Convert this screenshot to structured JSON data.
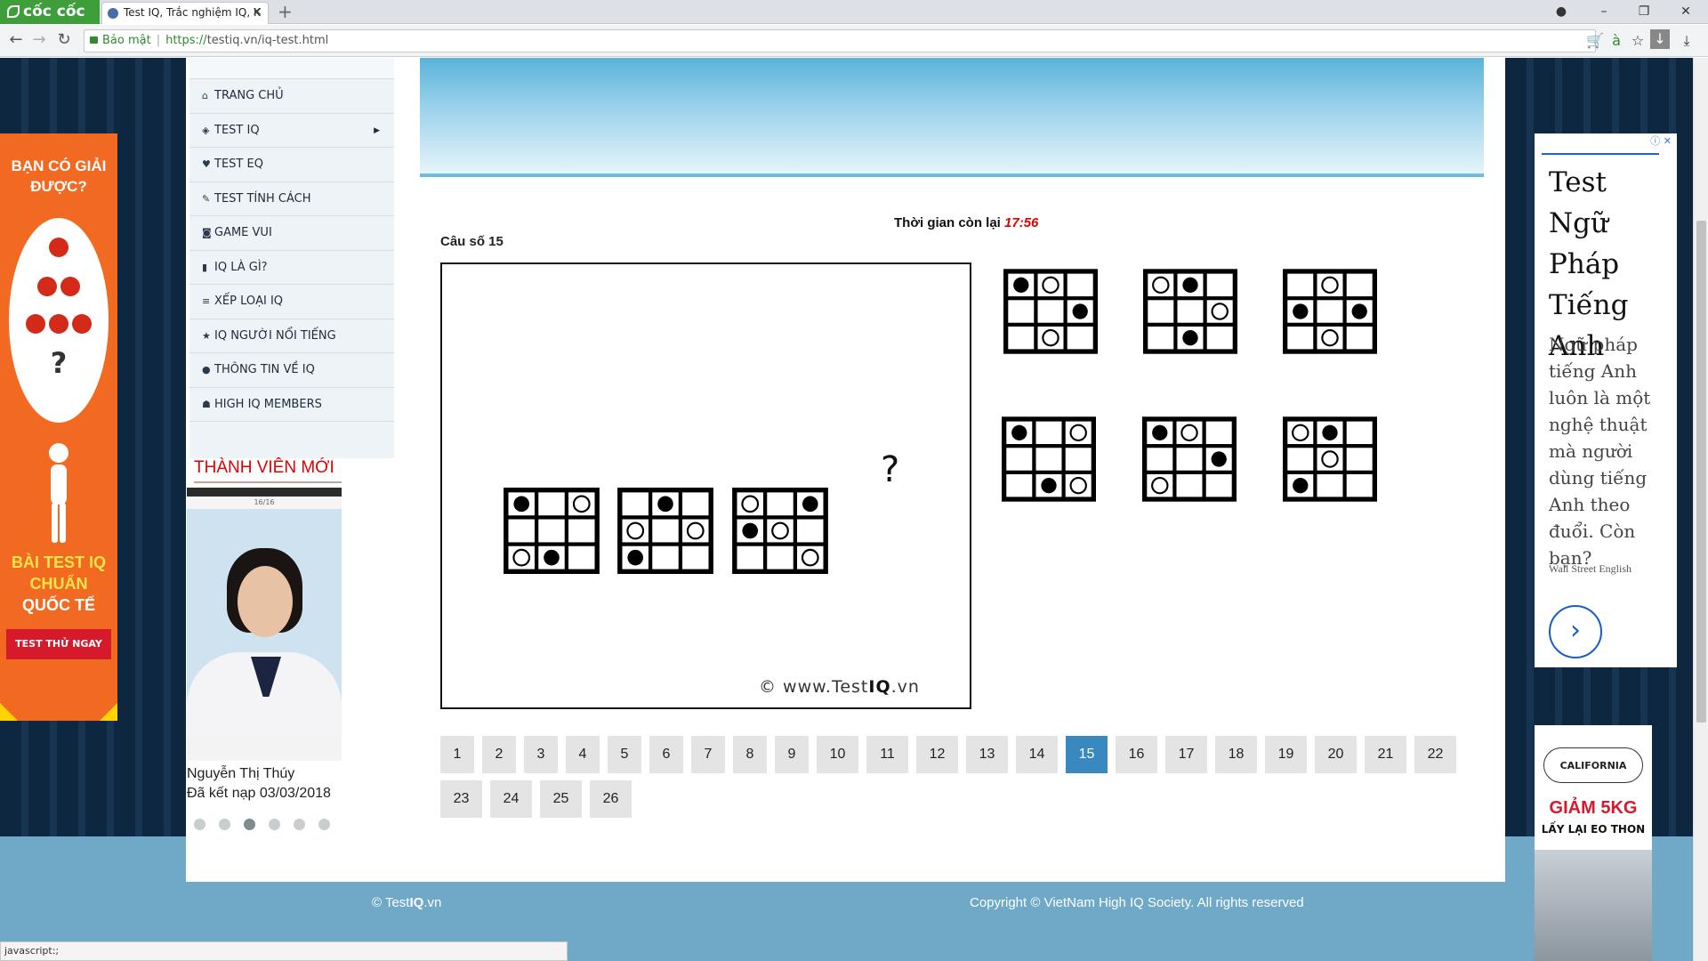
{
  "browser": {
    "brand": "cốc cốc",
    "tab_title": "Test IQ, Trắc nghiệm IQ, K",
    "secure_label": "Bảo mật",
    "url_https": "https://",
    "url_rest": "testiq.vn/iq-test.html"
  },
  "menu": {
    "items": [
      {
        "label": "Trang chủ",
        "icon": "home-icon"
      },
      {
        "label": "Test IQ",
        "icon": "brain-icon",
        "has_submenu": true
      },
      {
        "label": "Test EQ",
        "icon": "heart-icon"
      },
      {
        "label": "Test tính cách",
        "icon": "chat-icon"
      },
      {
        "label": "Game vui",
        "icon": "gamepad-icon"
      },
      {
        "label": "IQ là gì?",
        "icon": "book-icon"
      },
      {
        "label": "Xếp loại IQ",
        "icon": "list-icon"
      },
      {
        "label": "IQ người nổi tiếng",
        "icon": "star-icon"
      },
      {
        "label": "Thông tin về IQ",
        "icon": "info-icon"
      },
      {
        "label": "High IQ members",
        "icon": "users-icon"
      }
    ]
  },
  "new_members": {
    "title": "THÀNH VIÊN MỚI",
    "photo_header": "16/16",
    "name": "Nguyễn Thị Thúy",
    "joined": "Đã kết nạp 03/03/2018",
    "dot_count": 6,
    "active_dot": 3
  },
  "ad_left": {
    "top": "BẠN CÓ GIẢI ĐƯỢC?",
    "question": "?",
    "bottom_line1": "BÀI TEST IQ",
    "bottom_line2": "CHUẨN",
    "bottom_line3": "QUỐC TẾ",
    "cta": "TEST THỬ NGAY"
  },
  "quiz": {
    "timer_label": "Thời gian còn lại",
    "timer_value": "17:56",
    "question_label": "Câu số 15",
    "missing_mark": "?",
    "watermark_prefix": "© www.Test",
    "watermark_bold": "IQ",
    "watermark_suffix": ".vn"
  },
  "puzzle": {
    "sequence": [
      {
        "cells": [
          "B",
          "",
          "W",
          "",
          "",
          "",
          "W",
          "B",
          ""
        ]
      },
      {
        "cells": [
          "",
          "B",
          "",
          "W",
          "",
          "W",
          "B",
          "",
          ""
        ]
      },
      {
        "cells": [
          "W",
          "",
          "B",
          "B",
          "W",
          "",
          "",
          "",
          "W"
        ]
      }
    ],
    "answers": [
      {
        "cells": [
          "B",
          "W",
          "",
          "",
          "",
          "B",
          "",
          "W",
          ""
        ]
      },
      {
        "cells": [
          "W",
          "B",
          "",
          "",
          "",
          "W",
          "",
          "B",
          ""
        ]
      },
      {
        "cells": [
          "",
          "W",
          "",
          "B",
          "",
          "B",
          "",
          "W",
          ""
        ]
      },
      {
        "cells": [
          "B",
          "",
          "W",
          "",
          "",
          "",
          "",
          "B",
          "W"
        ]
      },
      {
        "cells": [
          "B",
          "W",
          "",
          "",
          "",
          "B",
          "W",
          "",
          ""
        ]
      },
      {
        "cells": [
          "W",
          "B",
          "",
          "",
          "W",
          "",
          "B",
          "",
          ""
        ]
      }
    ]
  },
  "pagination": {
    "pages": [
      "1",
      "2",
      "3",
      "4",
      "5",
      "6",
      "7",
      "8",
      "9",
      "10",
      "11",
      "12",
      "13",
      "14",
      "15",
      "16",
      "17",
      "18",
      "19",
      "20",
      "21",
      "22",
      "23",
      "24",
      "25",
      "26"
    ],
    "current": "15"
  },
  "ad_right_top": {
    "headline": "Test Ngữ Pháp Tiếng Anh",
    "body": "Ngữ pháp tiếng Anh luôn là một nghệ thuật mà người dùng tiếng Anh theo đuổi. Còn bạn?",
    "source": "Wall Street English",
    "cta_icon": "chevron-right-icon"
  },
  "ad_right_bottom": {
    "logo": "CALIFORNIA",
    "headline": "GIẢM 5KG",
    "sub": "LẤY LẠI EO THON"
  },
  "footer": {
    "left_prefix": "© Test",
    "left_bold": "IQ",
    "left_suffix": ".vn",
    "right": "Copyright © VietNam High IQ Society. All rights reserved"
  },
  "status_bar": "javascript:;",
  "colors": {
    "accent": "#3a88c0",
    "timer": "#e00000",
    "brand": "#3d9e3a",
    "page_bg": "#0e2740"
  }
}
